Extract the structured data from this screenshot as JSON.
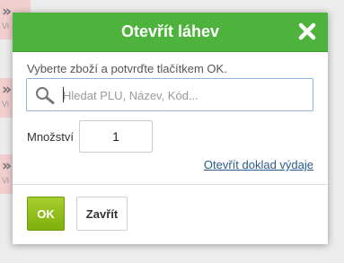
{
  "background": {
    "tiles": [
      {
        "chevron": "»",
        "text": "Vi"
      },
      {
        "chevron": "»",
        "text": "Vi"
      },
      {
        "chevron": "»",
        "text": "Vi"
      }
    ]
  },
  "dialog": {
    "title": "Otevřít láhev",
    "close_icon": "close-x-icon",
    "instruction": "Vyberte zboží a potvrďte tlačítkem OK.",
    "search": {
      "icon": "search-icon",
      "placeholder": "Hledat PLU, Název, Kód...",
      "value": ""
    },
    "quantity": {
      "label": "Množství",
      "value": "1"
    },
    "receipt_link": "Otevřít doklad výdaje",
    "buttons": {
      "ok": "OK",
      "close": "Zavřít"
    },
    "colors": {
      "header": "#4db33d",
      "ok_button": "#8dbd1a",
      "link": "#2a5b8c"
    }
  }
}
